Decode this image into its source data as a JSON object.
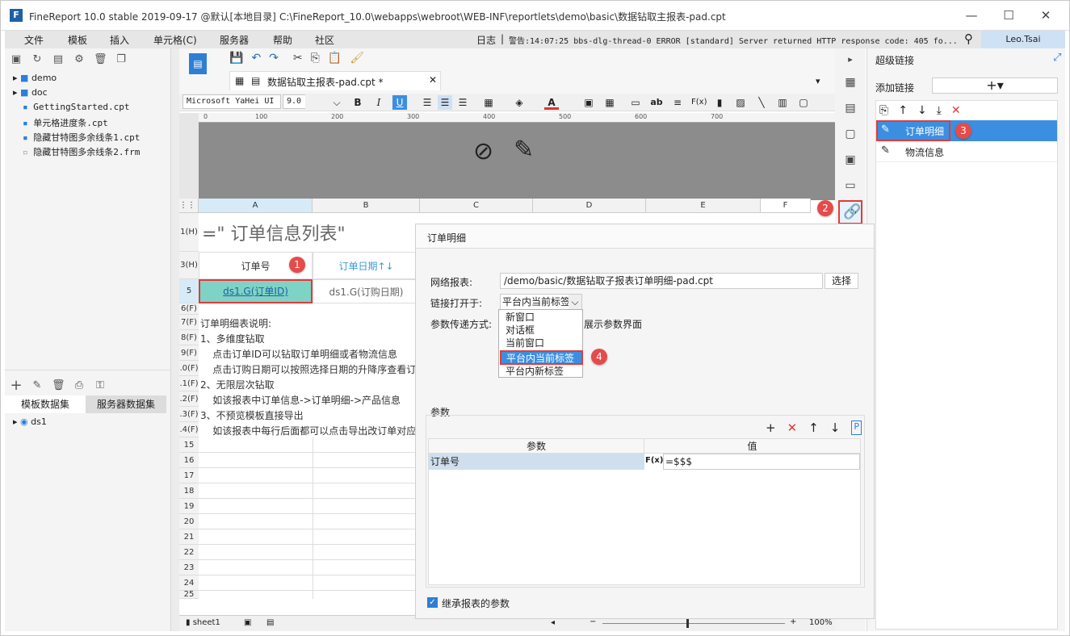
{
  "window": {
    "title": "FineReport 10.0 stable 2019-09-17 @默认[本地目录]",
    "path": "C:\\FineReport_10.0\\webapps\\webroot\\WEB-INF\\reportlets\\demo\\basic\\数据钻取主报表-pad.cpt"
  },
  "menu": [
    "文件",
    "模板",
    "插入",
    "单元格(C)",
    "服务器",
    "帮助",
    "社区"
  ],
  "log": {
    "label": "日志",
    "text": "警告:14:07:25 bbs-dlg-thread-0 ERROR [standard] Server returned HTTP response code: 405 fo..."
  },
  "user": "Leo.Tsai",
  "file_tree": [
    {
      "name": "demo",
      "type": "folder"
    },
    {
      "name": "doc",
      "type": "folder"
    },
    {
      "name": "GettingStarted.cpt",
      "type": "cpt"
    },
    {
      "name": "单元格进度条.cpt",
      "type": "cpt"
    },
    {
      "name": "隐藏甘特图多余线条1.cpt",
      "type": "cpt"
    },
    {
      "name": "隐藏甘特图多余线条2.frm",
      "type": "frm"
    }
  ],
  "dataset_tabs": {
    "template": "模板数据集",
    "server": "服务器数据集"
  },
  "datasets": [
    "ds1"
  ],
  "editor_tab": "数据钻取主报表-pad.cpt *",
  "font": {
    "family": "Microsoft YaHei UI",
    "size": "9.0"
  },
  "ruler_ticks": [
    "0",
    "100",
    "200",
    "300",
    "400",
    "500",
    "600",
    "700"
  ],
  "columns": [
    "A",
    "B",
    "C",
    "D",
    "E",
    "F"
  ],
  "rows": {
    "r1": {
      "label": "1(H)",
      "text": "=\" 订单信息列表\""
    },
    "r3": {
      "label": "3(H)",
      "a": "订单号",
      "b": "订单日期↑↓"
    },
    "r5": {
      "label": "5",
      "a": "ds1.G(订单ID)",
      "b": "ds1.G(订购日期)"
    },
    "r6": {
      "label": "6(F)"
    },
    "notes": [
      {
        "label": "7(F)",
        "text": "订单明细表说明:"
      },
      {
        "label": "8(F)",
        "text": "1、多维度钻取"
      },
      {
        "label": "9(F)",
        "text": "    点击订单ID可以钻取订单明细或者物流信息"
      },
      {
        "label": ".0(F)",
        "text": "    点击订购日期可以按照选择日期的升降序查看订"
      },
      {
        "label": ".1(F)",
        "text": "2、无限层次钻取"
      },
      {
        "label": ".2(F)",
        "text": "    如该报表中订单信息->订单明细->产品信息"
      },
      {
        "label": ".3(F)",
        "text": "3、不预览模板直接导出"
      },
      {
        "label": ".4(F)",
        "text": "    如该报表中每行后面都可以点击导出改订单对应"
      }
    ],
    "empty": [
      "15",
      "16",
      "17",
      "18",
      "19",
      "20",
      "21",
      "22",
      "23",
      "24",
      "25"
    ]
  },
  "sheet": "sheet1",
  "zoom": "100%",
  "hyperlink_panel": {
    "title": "超级链接",
    "add_label": "添加链接",
    "items": [
      "订单明细",
      "物流信息"
    ]
  },
  "dialog": {
    "title": "订单明细",
    "report_label": "网络报表:",
    "report_value": "/demo/basic/数据钻取子报表订单明细-pad.cpt",
    "select_btn": "选择",
    "open_label": "链接打开于:",
    "open_value": "平台内当前标签",
    "param_mode_label": "参数传递方式:",
    "show_param_text": "展示参数界面",
    "dropdown_options": [
      "新窗口",
      "对话框",
      "当前窗口",
      "平台内当前标签",
      "平台内新标签"
    ],
    "params_title": "参数",
    "params_headers": [
      "参数",
      "值"
    ],
    "params_rows": [
      {
        "name": "订单号",
        "value": "=$$$"
      }
    ],
    "inherit_label": "继承报表的参数"
  },
  "badges": [
    "1",
    "2",
    "3",
    "4"
  ],
  "colors": {
    "accent": "#3c8fe0",
    "highlight_red": "#e03b3b",
    "cell_green": "#7fd3c4"
  }
}
